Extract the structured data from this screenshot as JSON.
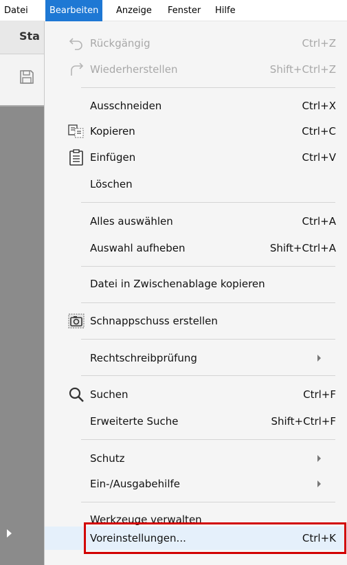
{
  "menubar": {
    "items": [
      {
        "label": "Datei"
      },
      {
        "label": "Bearbeiten"
      },
      {
        "label": "Anzeige"
      },
      {
        "label": "Fenster"
      },
      {
        "label": "Hilfe"
      }
    ]
  },
  "background": {
    "tab_label": "Sta",
    "save_icon": "save-icon",
    "expand_icon": "chevron-right-icon"
  },
  "menu": {
    "items": [
      {
        "label": "Rückgängig",
        "shortcut": "Ctrl+Z",
        "icon": "undo-icon",
        "enabled": false
      },
      {
        "label": "Wiederherstellen",
        "shortcut": "Shift+Ctrl+Z",
        "icon": "redo-icon",
        "enabled": false
      },
      {
        "label": "Ausschneiden",
        "shortcut": "Ctrl+X"
      },
      {
        "label": "Kopieren",
        "shortcut": "Ctrl+C",
        "icon": "copy-icon"
      },
      {
        "label": "Einfügen",
        "shortcut": "Ctrl+V",
        "icon": "paste-icon"
      },
      {
        "label": "Löschen",
        "shortcut": ""
      },
      {
        "label": "Alles auswählen",
        "shortcut": "Ctrl+A"
      },
      {
        "label": "Auswahl aufheben",
        "shortcut": "Shift+Ctrl+A"
      },
      {
        "label": "Datei in Zwischenablage kopieren",
        "shortcut": ""
      },
      {
        "label": "Schnappschuss erstellen",
        "shortcut": "",
        "icon": "camera-icon"
      },
      {
        "label": "Rechtschreibprüfung",
        "submenu": true
      },
      {
        "label": "Suchen",
        "shortcut": "Ctrl+F",
        "icon": "search-icon"
      },
      {
        "label": "Erweiterte Suche",
        "shortcut": "Shift+Ctrl+F"
      },
      {
        "label": "Schutz",
        "submenu": true
      },
      {
        "label": "Ein-/Ausgabehilfe",
        "submenu": true
      },
      {
        "label": "Werkzeuge verwalten",
        "shortcut": ""
      },
      {
        "label": "Voreinstellungen...",
        "shortcut": "Ctrl+K",
        "highlighted": true
      }
    ]
  },
  "colors": {
    "menubar_active": "#1e78d4",
    "menu_bg": "#f5f5f5",
    "highlight_border": "#d20000",
    "disabled_text": "#a8a8a8"
  }
}
